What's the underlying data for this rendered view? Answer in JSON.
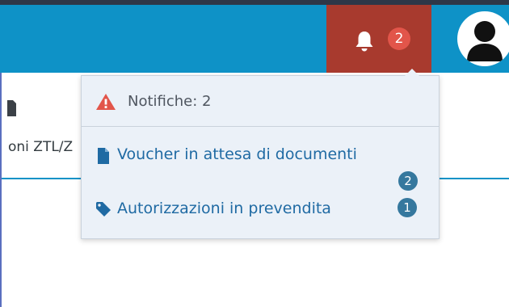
{
  "navbar": {
    "notifications_button": {
      "count": "2",
      "icon": "bell-icon"
    },
    "avatar_icon": "user-avatar-icon"
  },
  "background": {
    "partial_text": "oni ZTL/Z",
    "icon": "document-icon"
  },
  "notifications_dropdown": {
    "title": "Notifiche: 2",
    "title_icon": "warning-icon",
    "items": [
      {
        "label": "Voucher in attesa di documenti",
        "icon": "file-icon",
        "count": "2"
      },
      {
        "label": "Autorizzazioni in prevendita",
        "icon": "tag-icon",
        "count": "1"
      }
    ]
  },
  "colors": {
    "navbar": "#0e92c7",
    "notification_button": "#a83a2e",
    "alert_badge": "#e2554a",
    "link": "#1f6aa3",
    "count_badge": "#35789e",
    "warning": "#e2554a",
    "dropdown_bg": "#ebf1f8"
  }
}
